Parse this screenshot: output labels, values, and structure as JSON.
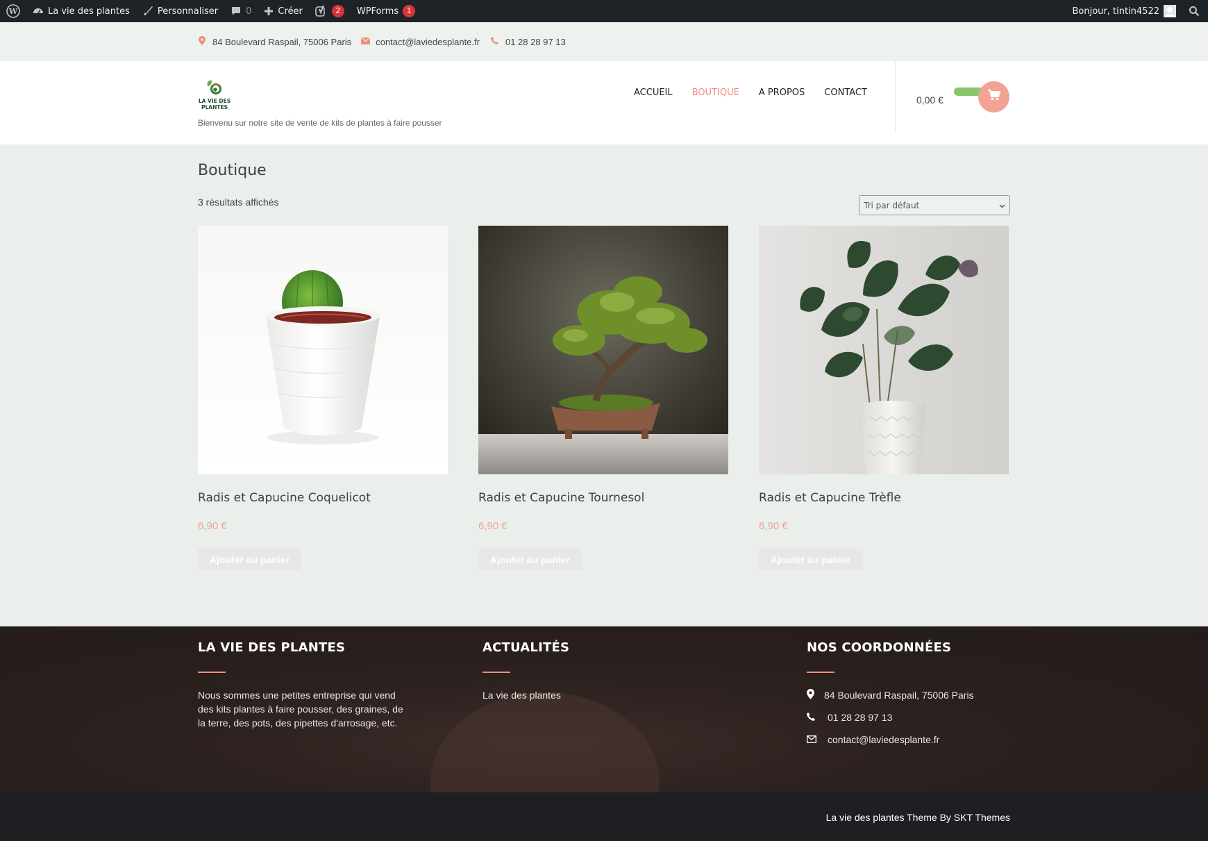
{
  "adminbar": {
    "site_name": "La vie des plantes",
    "customize": "Personnaliser",
    "comments_count": "0",
    "create": "Créer",
    "yoast_badge": "2",
    "wpforms": "WPForms",
    "wpforms_badge": "1",
    "greeting": "Bonjour, tintin4522"
  },
  "topbar": {
    "address": "84 Boulevard Raspail, 75006 Paris",
    "email": "contact@laviedesplante.fr",
    "phone": "01 28 28 97 13"
  },
  "header": {
    "logo_text_line1": "LA VIE DES",
    "logo_text_line2": "PLANTES",
    "tagline": "Bienvenu sur notre site de vente de kits de plantes à faire pousser",
    "nav": [
      "ACCUEIL",
      "BOUTIQUE",
      "A PROPOS",
      "CONTACT"
    ],
    "active_nav": "BOUTIQUE",
    "cart_total": "0,00 €"
  },
  "shop": {
    "title": "Boutique",
    "result_count": "3 résultats affichés",
    "sort_selected": "Tri par défaut",
    "products": [
      {
        "name": "Radis et Capucine Coquelicot",
        "price": "6,90 €",
        "button": "Ajouter au panier",
        "image": "cactus-photo"
      },
      {
        "name": "Radis et Capucine Tournesol",
        "price": "6,90 €",
        "button": "Ajouter au panier",
        "image": "bonsai-photo"
      },
      {
        "name": "Radis et Capucine Trèfle",
        "price": "6,90 €",
        "button": "Ajouter au panier",
        "image": "houseplant-photo"
      }
    ]
  },
  "footer": {
    "col1_title": "LA VIE DES PLANTES",
    "col1_text": "Nous sommes une petites entreprise qui vend des kits plantes à faire pousser, des graines, de la terre, des pots, des pipettes d'arrosage, etc.",
    "col2_title": "ACTUALITÉS",
    "col2_link": "La vie des plantes",
    "col3_title": "NOS COORDONNÉES",
    "address": "84 Boulevard Raspail, 75006 Paris",
    "phone": "01 28 28 97 13",
    "email": "contact@laviedesplante.fr",
    "credit": "La vie des plantes Theme By SKT Themes"
  },
  "colors": {
    "accent": "#f08e79",
    "price": "#f2a393",
    "admin_bar": "#1d2327",
    "badge": "#d63638"
  }
}
